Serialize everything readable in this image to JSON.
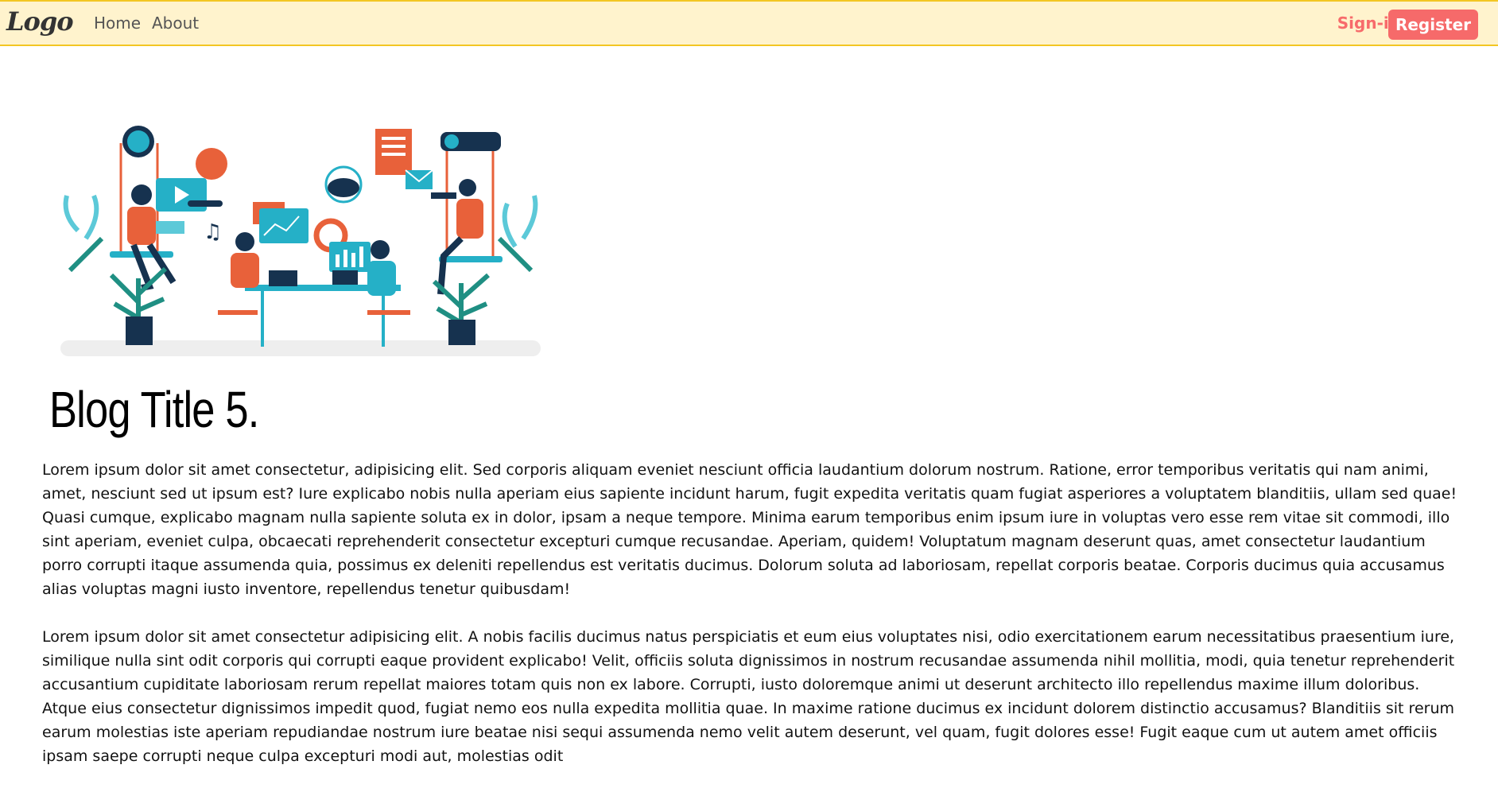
{
  "navbar": {
    "logo": "Logo",
    "links": [
      "Home",
      "About"
    ],
    "signin": "Sign-in",
    "register": "Register"
  },
  "hero": {
    "icon": "team-collaboration-illustration"
  },
  "post": {
    "title": "Blog Title 5.",
    "paragraphs": [
      "Lorem ipsum dolor sit amet consectetur, adipisicing elit. Sed corporis aliquam eveniet nesciunt officia laudantium dolorum nostrum. Ratione, error temporibus veritatis qui nam animi, amet, nesciunt sed ut ipsum est? Iure explicabo nobis nulla aperiam eius sapiente incidunt harum, fugit expedita veritatis quam fugiat asperiores a voluptatem blanditiis, ullam sed quae! Quasi cumque, explicabo magnam nulla sapiente soluta ex in dolor, ipsam a neque tempore. Minima earum temporibus enim ipsum iure in voluptas vero esse rem vitae sit commodi, illo sint aperiam, eveniet culpa, obcaecati reprehenderit consectetur excepturi cumque recusandae. Aperiam, quidem! Voluptatum magnam deserunt quas, amet consectetur laudantium porro corrupti itaque assumenda quia, possimus ex deleniti repellendus est veritatis ducimus. Dolorum soluta ad laboriosam, repellat corporis beatae. Corporis ducimus quia accusamus alias voluptas magni iusto inventore, repellendus tenetur quibusdam!",
      "Lorem ipsum dolor sit amet consectetur adipisicing elit. A nobis facilis ducimus natus perspiciatis et eum eius voluptates nisi, odio exercitationem earum necessitatibus praesentium iure, similique nulla sint odit corporis qui corrupti eaque provident explicabo! Velit, officiis soluta dignissimos in nostrum recusandae assumenda nihil mollitia, modi, quia tenetur reprehenderit accusantium cupiditate laboriosam rerum repellat maiores totam quis non ex labore. Corrupti, iusto doloremque animi ut deserunt architecto illo repellendus maxime illum doloribus. Atque eius consectetur dignissimos impedit quod, fugiat nemo eos nulla expedita mollitia quae. In maxime ratione ducimus ex incidunt dolorem distinctio accusamus? Blanditiis sit rerum earum molestias iste aperiam repudiandae nostrum iure beatae nisi sequi assumenda nemo velit autem deserunt, vel quam, fugit dolores esse! Fugit eaque cum ut autem amet officiis ipsam saepe corrupti neque culpa excepturi modi aut, molestias odit"
    ]
  }
}
